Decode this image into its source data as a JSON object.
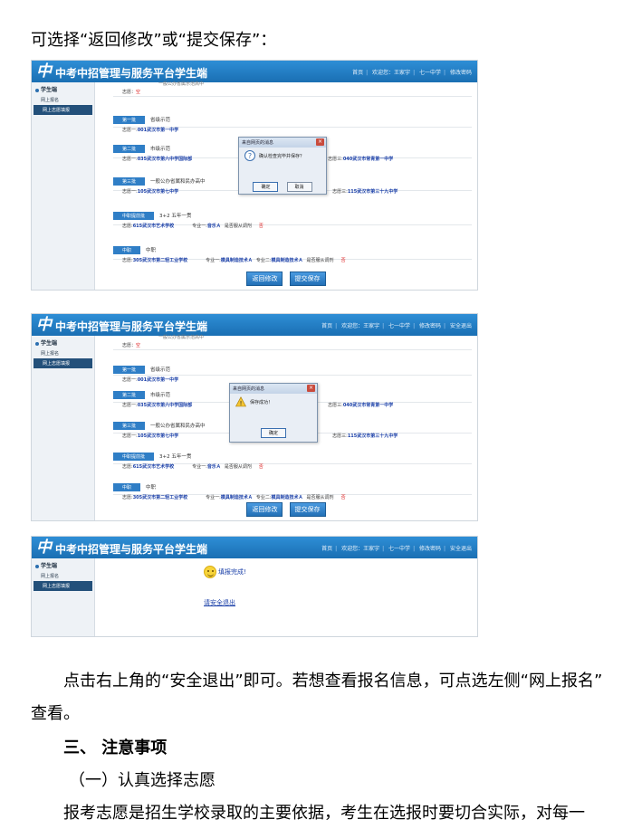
{
  "intro_text": "可选择“返回修改”或“提交保存”：",
  "app": {
    "logo_glyph": "中",
    "title": "中考中招管理与服务平台学生端",
    "nav": {
      "home": "首页",
      "welcome": "欢迎您：王家宇",
      "school": "七一中学",
      "change_password": "修改密码",
      "logout": "安全退出"
    },
    "sidebar": {
      "section": "学生端",
      "items": [
        "网上报名",
        "网上志愿填报"
      ]
    }
  },
  "form": {
    "top_line_partial": "一般公办省属示范高中",
    "top_choice": "志愿：",
    "top_choice_value": "空",
    "rows": [
      {
        "tag": "第一批",
        "desc": "省级示范",
        "line": {
          "label": "志愿一:",
          "school": "001武汉市第一中学"
        }
      },
      {
        "tag": "第二批",
        "desc": "市级示范",
        "line": {
          "label": "志愿一:",
          "school": "035武汉市第六中学国际部",
          "label2": "志愿三:",
          "school2": "040武汉市常青第一中学"
        }
      },
      {
        "tag": "第三批",
        "desc": "一般公办省属和民办高中",
        "line": {
          "label": "志愿一:",
          "school": "105武汉市第七中学",
          "label2": "志愿三:",
          "school2": "115武汉市第三十九中学"
        }
      },
      {
        "tag": "中职提前批",
        "desc": "3+2 五年一贯",
        "line": {
          "label": "志愿:",
          "school": "615武汉市艺术学校",
          "major_label": "专业一:",
          "major": "音乐Ａ",
          "obey": "是否服从调剂",
          "obey_value": "否"
        }
      },
      {
        "tag": "中职",
        "desc": "中职",
        "line": {
          "label": "志愿:",
          "school": "305武汉市第二轻工业学校",
          "major_label": "专业一:",
          "major": "模具制造技术Ａ",
          "major2_label": "专业二:",
          "major2": "模具制造技术Ａ",
          "obey": "是否服从调剂",
          "obey_value": "否"
        }
      }
    ],
    "buttons": {
      "back": "返回修改",
      "submit": "提交保存"
    }
  },
  "dialog1": {
    "title": "来自网页的消息",
    "message": "确认检查完毕并保存？",
    "ok": "确定",
    "cancel": "取消"
  },
  "dialog2": {
    "title": "来自网页的消息",
    "message": "保存成功！",
    "ok": "确定"
  },
  "done": {
    "message": "填报完成!",
    "logout_link": "请安全退出"
  },
  "after_text_1": "点击右上角的“安全退出”即可。若想查看报名信息，可点选左侧“网上报名”",
  "after_text_2": "查看。",
  "section_heading": "三、 注意事项",
  "sub_heading": "（一）认真选择志愿",
  "body_text": "报考志愿是招生学校录取的主要依据，考生在选报时要切合实际，对每一"
}
